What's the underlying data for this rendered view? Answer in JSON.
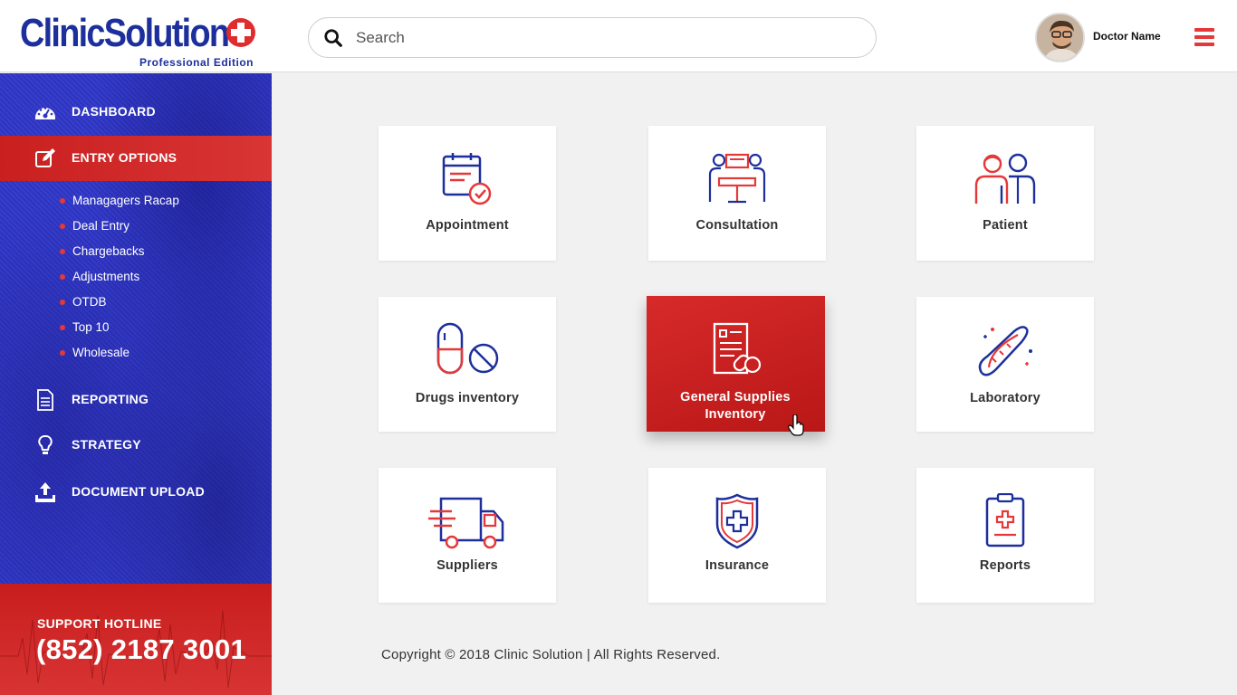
{
  "logo": {
    "name": "ClinicSolution",
    "edition": "Professional Edition"
  },
  "search": {
    "placeholder": "Search"
  },
  "user": {
    "name": "Doctor Name"
  },
  "sidebar": {
    "items": [
      {
        "label": "DASHBOARD",
        "icon": "dashboard-gauge-icon"
      },
      {
        "label": "ENTRY OPTIONS",
        "icon": "edit-icon",
        "active": true
      },
      {
        "label": "REPORTING",
        "icon": "document-icon"
      },
      {
        "label": "STRATEGY",
        "icon": "lightbulb-icon"
      },
      {
        "label": "DOCUMENT UPLOAD",
        "icon": "upload-icon"
      }
    ],
    "sub_items": [
      "Managagers Racap",
      "Deal Entry",
      "Chargebacks",
      "Adjustments",
      "OTDB",
      "Top 10",
      "Wholesale"
    ]
  },
  "hotline": {
    "label": "SUPPORT HOTLINE",
    "phone": "(852) 2187 3001"
  },
  "cards": [
    {
      "label": "Appointment",
      "icon": "calendar-check-icon"
    },
    {
      "label": "Consultation",
      "icon": "consultation-desk-icon"
    },
    {
      "label": "Patient",
      "icon": "patient-people-icon"
    },
    {
      "label": "Drugs inventory",
      "icon": "pill-icon"
    },
    {
      "label_line1": "General Supplies",
      "label_line2": "Inventory",
      "icon": "supplies-list-icon",
      "active": true
    },
    {
      "label": "Laboratory",
      "icon": "dna-icon"
    },
    {
      "label": "Suppliers",
      "icon": "delivery-truck-icon"
    },
    {
      "label": "Insurance",
      "icon": "shield-cross-icon"
    },
    {
      "label": "Reports",
      "icon": "clipboard-cross-icon"
    }
  ],
  "footer": {
    "copyright": "Copyright © 2018 Clinic Solution | All Rights Reserved."
  },
  "colors": {
    "brand_blue": "#1d2f9c",
    "sidebar_blue": "#2f36c8",
    "accent_red": "#d72a2a"
  }
}
